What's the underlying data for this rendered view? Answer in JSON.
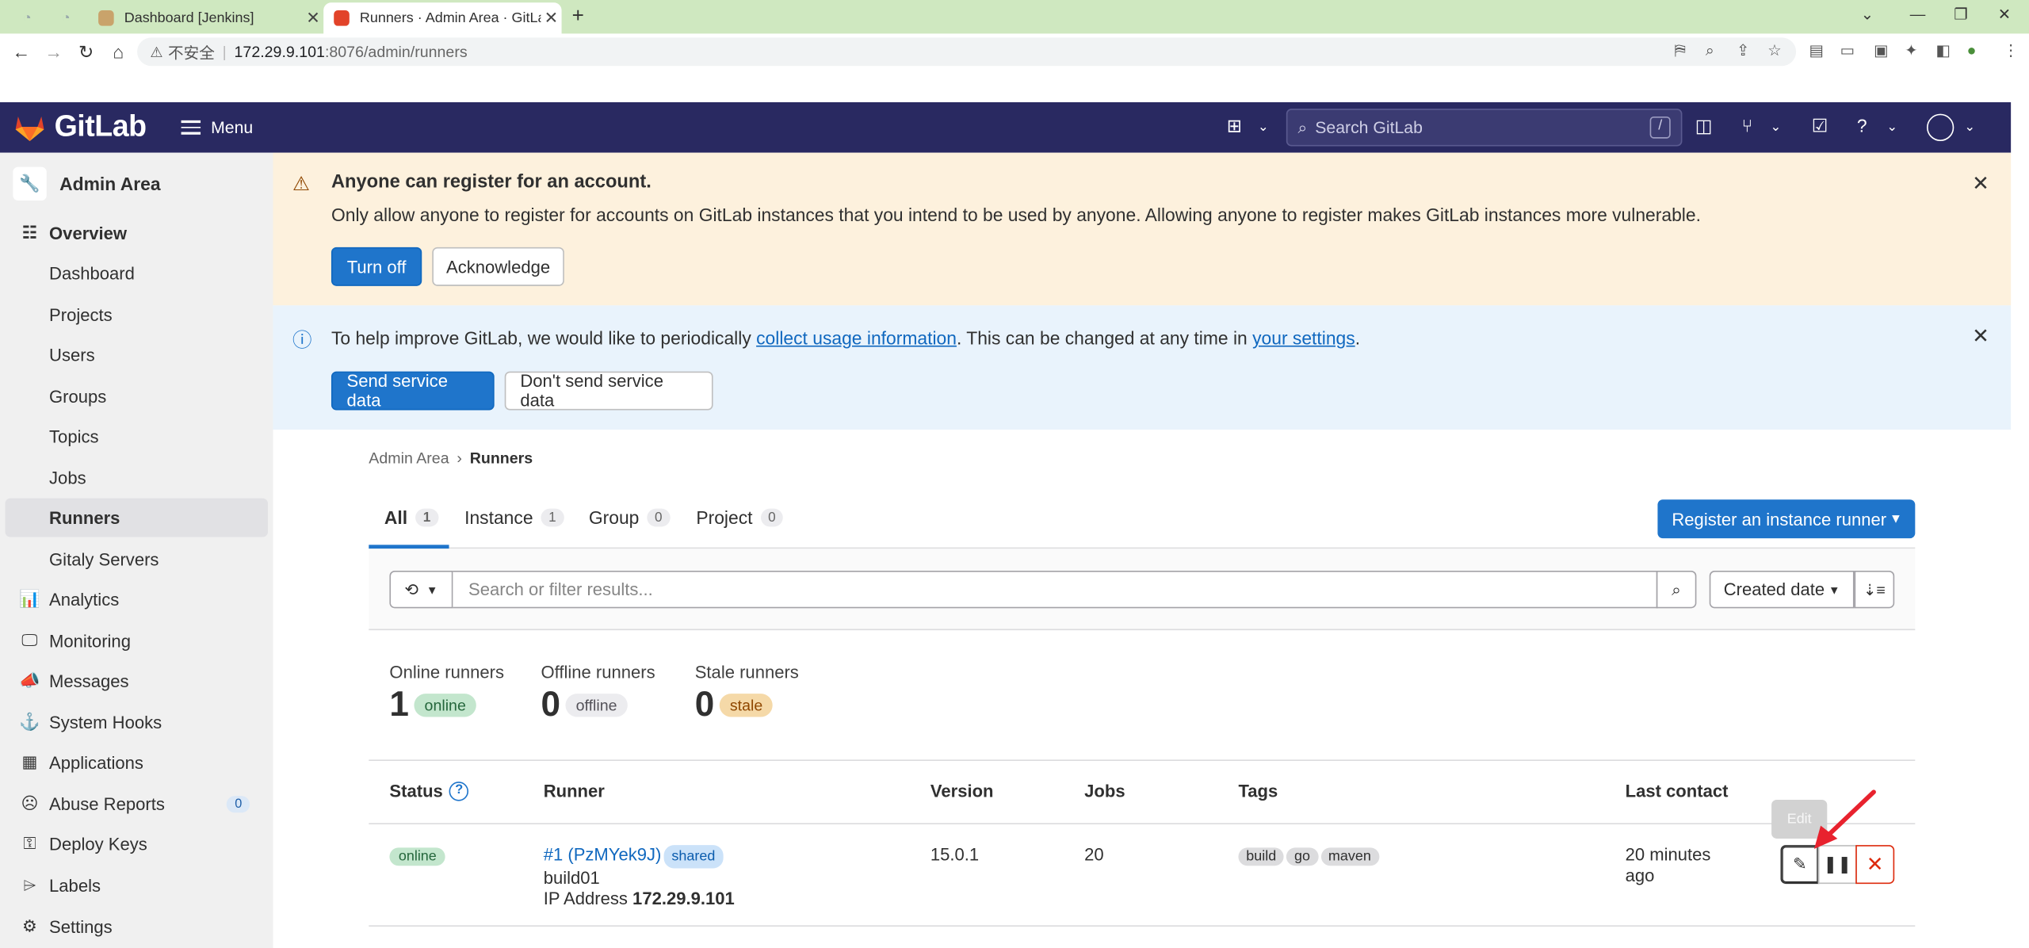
{
  "browser": {
    "tabs": [
      {
        "title": "Dashboard [Jenkins]"
      },
      {
        "title": "Runners · Admin Area · GitLab"
      }
    ],
    "address": {
      "security": "不安全",
      "host": "172.29.9.101",
      "path": ":8076/admin/runners"
    }
  },
  "header": {
    "logo_text": "GitLab",
    "menu_label": "Menu",
    "search_placeholder": "Search GitLab",
    "search_shortcut": "/"
  },
  "sidebar": {
    "title": "Admin Area",
    "items": [
      {
        "label": "Overview",
        "icon": "overview-icon",
        "bold": true
      },
      {
        "label": "Dashboard",
        "sub": true
      },
      {
        "label": "Projects",
        "sub": true
      },
      {
        "label": "Users",
        "sub": true
      },
      {
        "label": "Groups",
        "sub": true
      },
      {
        "label": "Topics",
        "sub": true
      },
      {
        "label": "Jobs",
        "sub": true
      },
      {
        "label": "Runners",
        "sub": true,
        "active": true
      },
      {
        "label": "Gitaly Servers",
        "sub": true
      },
      {
        "label": "Analytics",
        "icon": "analytics-icon"
      },
      {
        "label": "Monitoring",
        "icon": "monitoring-icon"
      },
      {
        "label": "Messages",
        "icon": "messages-icon"
      },
      {
        "label": "System Hooks",
        "icon": "hook-icon"
      },
      {
        "label": "Applications",
        "icon": "applications-icon"
      },
      {
        "label": "Abuse Reports",
        "icon": "abuse-icon",
        "count": "0"
      },
      {
        "label": "Deploy Keys",
        "icon": "key-icon"
      },
      {
        "label": "Labels",
        "icon": "label-icon"
      },
      {
        "label": "Settings",
        "icon": "settings-icon"
      }
    ]
  },
  "warning_alert": {
    "title": "Anyone can register for an account.",
    "body": "Only allow anyone to register for accounts on GitLab instances that you intend to be used by anyone. Allowing anyone to register makes GitLab instances more vulnerable.",
    "primary_label": "Turn off",
    "secondary_label": "Acknowledge"
  },
  "info_alert": {
    "text_before": "To help improve GitLab, we would like to periodically ",
    "link1": "collect usage information",
    "text_middle": ". This can be changed at any time in ",
    "link2": "your settings",
    "text_after": ".",
    "primary_label": "Send service data",
    "secondary_label": "Don't send service data"
  },
  "breadcrumb": {
    "parent": "Admin Area",
    "current": "Runners"
  },
  "runner_tabs": [
    {
      "label": "All",
      "count": "1",
      "active": true
    },
    {
      "label": "Instance",
      "count": "1"
    },
    {
      "label": "Group",
      "count": "0"
    },
    {
      "label": "Project",
      "count": "0"
    }
  ],
  "register_button": "Register an instance runner",
  "filter": {
    "placeholder": "Search or filter results...",
    "sort_label": "Created date"
  },
  "stats": [
    {
      "label": "Online runners",
      "value": "1",
      "badge": "online",
      "kind": "online"
    },
    {
      "label": "Offline runners",
      "value": "0",
      "badge": "offline",
      "kind": "offline"
    },
    {
      "label": "Stale runners",
      "value": "0",
      "badge": "stale",
      "kind": "stale"
    }
  ],
  "table": {
    "headers": {
      "status": "Status",
      "runner": "Runner",
      "version": "Version",
      "jobs": "Jobs",
      "tags": "Tags",
      "last_contact": "Last contact"
    },
    "rows": [
      {
        "status": "online",
        "runner_link": "#1 (PzMYek9J)",
        "runner_badge": "shared",
        "description": "build01",
        "ip_label": "IP Address",
        "ip": "172.29.9.101",
        "version": "15.0.1",
        "jobs": "20",
        "tags": [
          "build",
          "go",
          "maven"
        ],
        "last_contact_1": "20 minutes",
        "last_contact_2": "ago"
      }
    ]
  },
  "tooltip": "Edit",
  "colors": {
    "header_bg": "#292961",
    "primary": "#1f75cb",
    "warning_bg": "#fdf1dd",
    "info_bg": "#e9f3fc",
    "danger": "#dd2b0e"
  }
}
